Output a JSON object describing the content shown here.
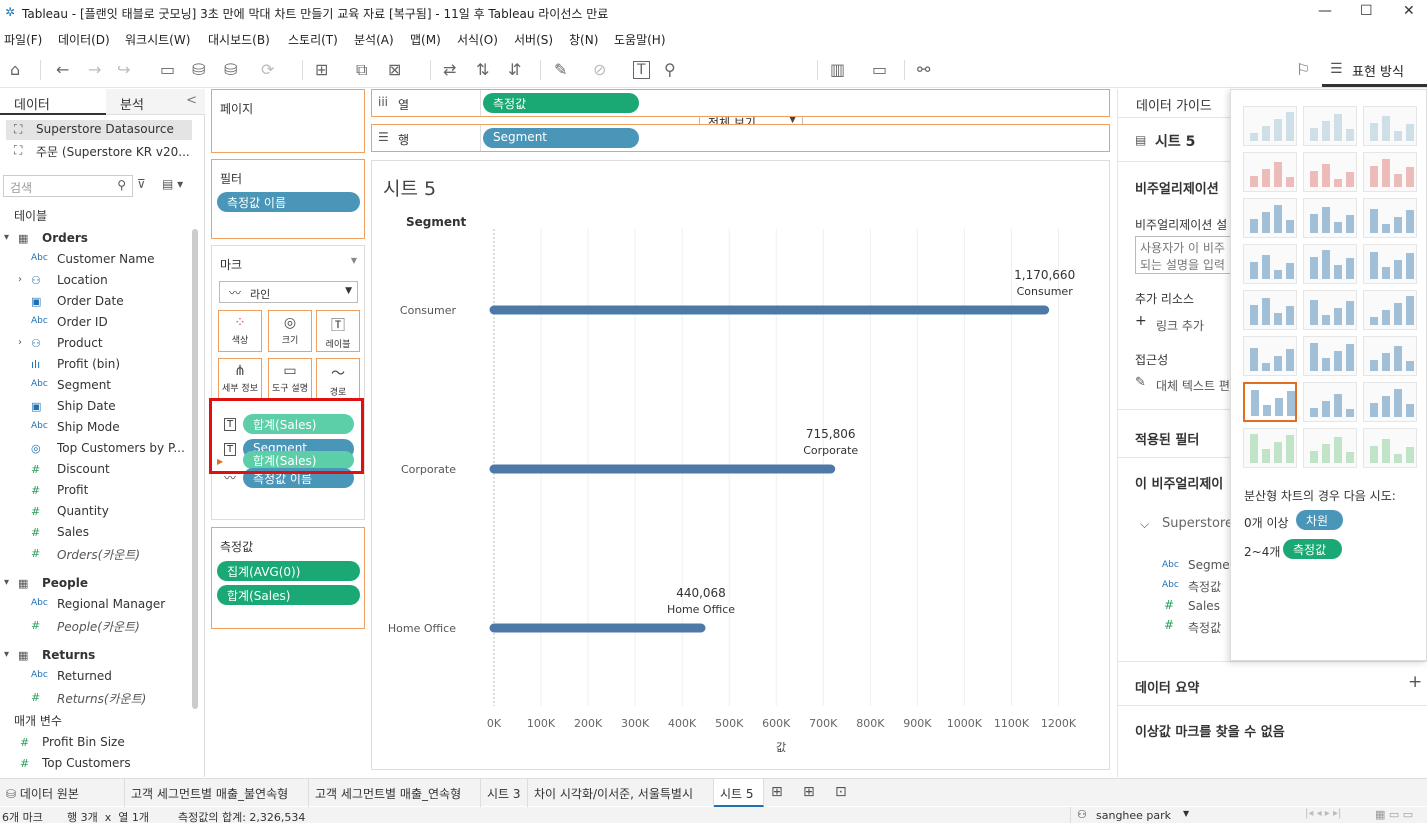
{
  "window": {
    "title": "Tableau - [플랜잇 태블로 굿모닝] 3초 만에 막대 차트 만들기 교육 자료 [복구됨] - 11일 후 Tableau 라이선스 만료",
    "minimize": "—",
    "maximize": "☐",
    "close": "✕"
  },
  "menu": [
    "파일(F)",
    "데이터(D)",
    "워크시트(W)",
    "대시보드(B)",
    "스토리(T)",
    "분석(A)",
    "맵(M)",
    "서식(O)",
    "서버(S)",
    "창(N)",
    "도움말(H)"
  ],
  "toolbar": {
    "view_select": "전체 보기",
    "show_me": "표현 방식"
  },
  "datapane": {
    "tab_data": "데이터",
    "tab_analysis": "분석",
    "collapse": "<",
    "datasources": [
      "Superstore Datasource",
      "주문 (Superstore KR v20..."
    ],
    "search_placeholder": "검색",
    "tables_header": "테이블",
    "orders": {
      "name": "Orders",
      "fields": [
        {
          "type": "Abc",
          "name": "Customer Name"
        },
        {
          "type": "geo",
          "name": "Location",
          "exp": true
        },
        {
          "type": "date",
          "name": "Order Date"
        },
        {
          "type": "Abc",
          "name": "Order ID"
        },
        {
          "type": "geo",
          "name": "Product",
          "exp": true
        },
        {
          "type": "bin",
          "name": "Profit (bin)"
        },
        {
          "type": "Abc",
          "name": "Segment"
        },
        {
          "type": "date",
          "name": "Ship Date"
        },
        {
          "type": "Abc",
          "name": "Ship Mode"
        },
        {
          "type": "set",
          "name": "Top Customers by P..."
        },
        {
          "type": "#",
          "name": "Discount"
        },
        {
          "type": "#",
          "name": "Profit"
        },
        {
          "type": "#",
          "name": "Quantity"
        },
        {
          "type": "#",
          "name": "Sales"
        },
        {
          "type": "#",
          "name": "Orders(카운트)",
          "italic": true
        }
      ]
    },
    "people": {
      "name": "People",
      "fields": [
        {
          "type": "Abc",
          "name": "Regional Manager"
        },
        {
          "type": "#",
          "name": "People(카운트)",
          "italic": true
        }
      ]
    },
    "returns": {
      "name": "Returns",
      "fields": [
        {
          "type": "Abc",
          "name": "Returned"
        },
        {
          "type": "#",
          "name": "Returns(카운트)",
          "italic": true
        }
      ]
    },
    "params_header": "매개 변수",
    "params": [
      {
        "type": "#",
        "name": "Profit Bin Size"
      },
      {
        "type": "#",
        "name": "Top Customers"
      }
    ]
  },
  "cards": {
    "pages": "페이지",
    "filters": "필터",
    "filter_pill": "측정값 이름",
    "marks": "마크",
    "mark_type": "라인",
    "mark_buttons": [
      "색상",
      "크기",
      "레이블",
      "세부 정보",
      "도구 설명",
      "경로"
    ],
    "mark_pills": [
      "합계(Sales)",
      "Segment",
      "합계(Sales)",
      "측정값 이름"
    ],
    "measures": "측정값",
    "measure_pills": [
      "집계(AVG(0))",
      "합계(Sales)"
    ]
  },
  "shelves": {
    "columns": "열",
    "columns_pill": "측정값",
    "rows": "행",
    "rows_pill": "Segment"
  },
  "chart_data": {
    "type": "bar",
    "title": "시트 5",
    "row_header": "Segment",
    "categories": [
      "Consumer",
      "Corporate",
      "Home Office"
    ],
    "values": [
      1170660,
      715806,
      440068
    ],
    "value_labels": [
      "1,170,660",
      "715,806",
      "440,068"
    ],
    "xlabel": "값",
    "xlim": [
      0,
      1250000
    ],
    "x_ticks": [
      0,
      100000,
      200000,
      300000,
      400000,
      500000,
      600000,
      700000,
      800000,
      900000,
      1000000,
      1100000,
      1200000
    ],
    "x_tick_labels": [
      "0K",
      "100K",
      "200K",
      "300K",
      "400K",
      "500K",
      "600K",
      "700K",
      "800K",
      "900K",
      "1000K",
      "1100K",
      "1200K"
    ],
    "bar_color": "#4e79a7",
    "grid": true
  },
  "guide": {
    "title": "데이터 가이드",
    "sheet": "시트 5",
    "viz_desc": "비주얼리제이션",
    "viz_desc2": "비주얼리제이션 설",
    "desc_placeholder": "사용자가 이 비주\n되는 설명을 입력",
    "add_resources": "추가 리소스",
    "add_link": "링크 추가",
    "accessibility": "접근성",
    "alt_text": "대체 텍스트 편",
    "applied_filters": "적용된 필터",
    "this_viz": "이 비주얼리제이",
    "datasource": "Superstore",
    "fields": [
      {
        "type": "Abc",
        "name": "Segmen"
      },
      {
        "type": "Abc",
        "name": "측정값 "
      },
      {
        "type": "#",
        "name": "Sales"
      },
      {
        "type": "#",
        "name": "측정값"
      }
    ],
    "data_summary": "데이터 요약",
    "plus": "+",
    "outliers": "이상값 마크를 찾을 수 없음"
  },
  "showme": {
    "hint": "분산형 차트의 경우 다음 시도:",
    "line1_prefix": "0개 이상",
    "line1_pill": "차원",
    "line2_prefix": "2~4개",
    "line2_pill": "측정값"
  },
  "tabs": [
    "데이터 원본",
    "고객 세그먼트별 매출_불연속형",
    "고객 세그먼트별 매출_연속형",
    "시트 3",
    "차이 시각화/이서준, 서울특별시",
    "시트 5"
  ],
  "status": {
    "marks": "6개 마크",
    "rows": "행 3개  x  열 1개",
    "sum": "측정값의 합계: 2,326,534",
    "user": "sanghee park"
  }
}
